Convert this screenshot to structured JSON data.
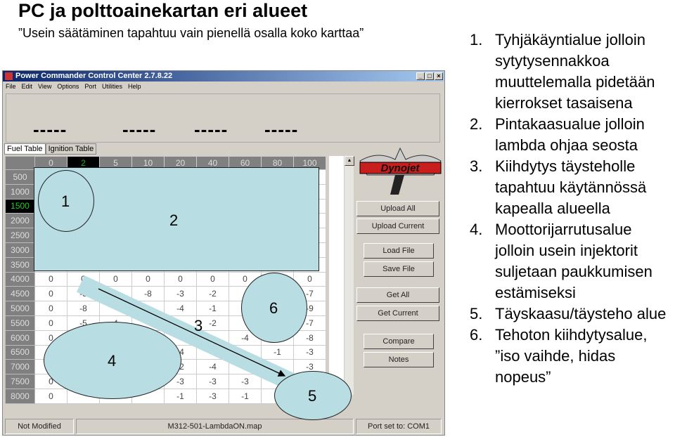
{
  "slide": {
    "title": "PC ja polttoainekartan eri alueet",
    "subtitle": "”Usein säätäminen tapahtuu vain pienellä osalla koko karttaa”",
    "items": [
      {
        "num": "1.",
        "text": "Tyhjäkäyntialue jolloin sytytysennakkoa muuttelemalla pidetään kierrokset tasaisena"
      },
      {
        "num": "2.",
        "text": "Pintakaasualue jolloin lambda ohjaa seosta"
      },
      {
        "num": "3.",
        "text": "Kiihdytys täysteholle tapahtuu käytännössä kapealla alueella"
      },
      {
        "num": "4.",
        "text": "Moottorijarrutusalue jolloin usein injektorit suljetaan paukkumisen estämiseksi"
      },
      {
        "num": "5.",
        "text": "Täyskaasu/täysteho alue"
      },
      {
        "num": "6.",
        "text": "Tehoton kiihdytysalue, ”iso vaihde, hidas nopeus”"
      }
    ]
  },
  "window": {
    "title": "Power Commander Control Center  2.7.8.22",
    "menu": [
      "File",
      "Edit",
      "View",
      "Options",
      "Port",
      "Utilities",
      "Help"
    ],
    "gauges": [
      "-----",
      "-----",
      "-----",
      "-----"
    ],
    "tabs": [
      "Fuel Table",
      "Ignition Table"
    ],
    "columns": [
      "0",
      "2",
      "5",
      "10",
      "20",
      "40",
      "60",
      "80",
      "100"
    ],
    "selected_column": "2",
    "selected_row": "1500",
    "rows": [
      {
        "rpm": "500",
        "v": [
          "",
          "",
          "",
          "",
          "",
          "",
          "",
          "",
          ""
        ]
      },
      {
        "rpm": "1000",
        "v": [
          "",
          "",
          "",
          "",
          "",
          "",
          "",
          "",
          ""
        ]
      },
      {
        "rpm": "1500",
        "v": [
          "",
          "",
          "",
          "",
          "",
          "",
          "",
          "",
          ""
        ]
      },
      {
        "rpm": "2000",
        "v": [
          "",
          "",
          "",
          "",
          "",
          "",
          "",
          "",
          ""
        ]
      },
      {
        "rpm": "2500",
        "v": [
          "",
          "",
          "",
          "",
          "",
          "",
          "",
          "",
          ""
        ]
      },
      {
        "rpm": "3000",
        "v": [
          "",
          "",
          "",
          "",
          "",
          "",
          "",
          "",
          ""
        ]
      },
      {
        "rpm": "3500",
        "v": [
          "",
          "",
          "",
          "",
          "",
          "",
          "",
          "",
          ""
        ]
      },
      {
        "rpm": "4000",
        "v": [
          "0",
          "0",
          "0",
          "0",
          "0",
          "0",
          "0",
          "",
          "0"
        ]
      },
      {
        "rpm": "4500",
        "v": [
          "0",
          "-3",
          "",
          "-8",
          "-3",
          "-2",
          "",
          "",
          "-7"
        ]
      },
      {
        "rpm": "5000",
        "v": [
          "0",
          "-8",
          "",
          "",
          "-4",
          "-1",
          "",
          "",
          "-9"
        ]
      },
      {
        "rpm": "5500",
        "v": [
          "0",
          "-5",
          "4",
          "",
          "",
          "-2",
          "",
          "",
          "-7"
        ]
      },
      {
        "rpm": "6000",
        "v": [
          "0",
          "",
          "",
          "",
          "",
          "",
          "-4",
          "",
          "-8"
        ]
      },
      {
        "rpm": "6500",
        "v": [
          "",
          "",
          "",
          "",
          "-4",
          "",
          "",
          "-1",
          "-3"
        ]
      },
      {
        "rpm": "7000",
        "v": [
          "",
          "",
          "",
          "",
          "-2",
          "-4",
          "",
          "",
          "-3"
        ]
      },
      {
        "rpm": "7500",
        "v": [
          "0",
          "",
          "",
          "",
          "-3",
          "-3",
          "-3",
          "",
          ""
        ]
      },
      {
        "rpm": "8000",
        "v": [
          "0",
          "",
          "",
          "",
          "-1",
          "-3",
          "-1",
          "",
          ""
        ]
      }
    ],
    "buttons": {
      "upload_all": "Upload All",
      "upload_current": "Upload Current",
      "load_file": "Load File",
      "save_file": "Save File",
      "get_all": "Get All",
      "get_current": "Get Current",
      "compare": "Compare",
      "notes": "Notes"
    },
    "logo": "Dynojet",
    "status": {
      "modified": "Not Modified",
      "file": "M312-501-LambdaON.map",
      "port": "Port set to: COM1"
    }
  },
  "annotations": {
    "labels": [
      "1",
      "2",
      "3",
      "4",
      "5",
      "6"
    ],
    "fill": "#b8dde3"
  }
}
